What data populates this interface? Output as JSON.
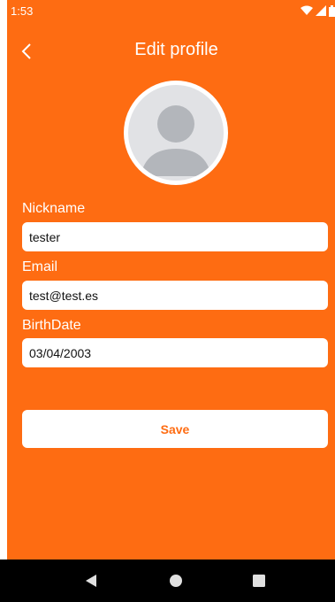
{
  "status_bar": {
    "time": "1:53",
    "icons": [
      "wifi-icon",
      "signal-icon",
      "battery-icon"
    ]
  },
  "header": {
    "title": "Edit profile",
    "back_icon": "chevron-left-icon"
  },
  "avatar": {
    "icon": "person-placeholder-icon"
  },
  "form": {
    "nickname": {
      "label": "Nickname",
      "value": "tester"
    },
    "email": {
      "label": "Email",
      "value": "test@test.es"
    },
    "birthdate": {
      "label": "BirthDate",
      "value": "03/04/2003"
    }
  },
  "actions": {
    "save_label": "Save"
  },
  "nav_bar": {
    "icons": [
      "back-triangle-icon",
      "home-circle-icon",
      "recents-square-icon"
    ]
  },
  "colors": {
    "primary": "#fe6c12",
    "surface": "#ffffff",
    "avatar_bg": "#e1e2e5",
    "avatar_fg": "#b3b6bb",
    "nav_bg": "#000000"
  }
}
